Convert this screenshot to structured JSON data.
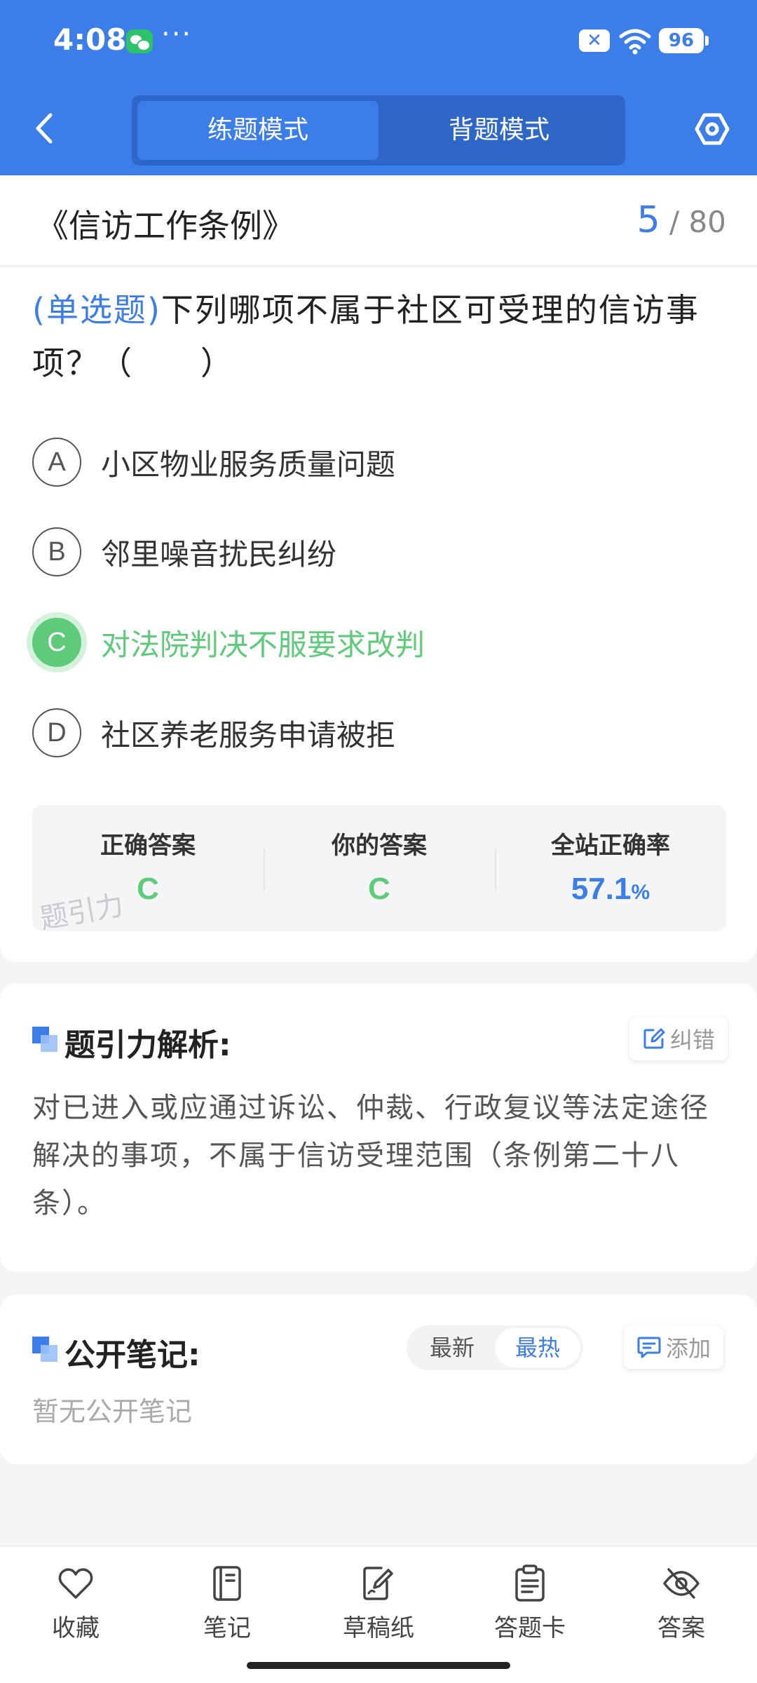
{
  "status_bar": {
    "time": "4:08",
    "dots": "···",
    "battery": "96"
  },
  "header": {
    "tabs": [
      {
        "label": "练题模式",
        "active": true
      },
      {
        "label": "背题模式",
        "active": false
      }
    ]
  },
  "title_bar": {
    "book_title": "《信访工作条例》",
    "current": "5",
    "separator": "/",
    "total": "80"
  },
  "question": {
    "type": "(单选题)",
    "text": "下列哪项不属于社区可受理的信访事项？（　　）",
    "options": [
      {
        "letter": "A",
        "text": "小区物业服务质量问题"
      },
      {
        "letter": "B",
        "text": "邻里噪音扰民纠纷"
      },
      {
        "letter": "C",
        "text": "对法院判决不服要求改判",
        "correct": true
      },
      {
        "letter": "D",
        "text": "社区养老服务申请被拒"
      }
    ]
  },
  "answers": {
    "correct_label": "正确答案",
    "correct_value": "C",
    "yours_label": "你的答案",
    "yours_value": "C",
    "rate_label": "全站正确率",
    "rate_value": "57.1",
    "rate_unit": "%",
    "watermark": "题引力"
  },
  "analysis": {
    "title": "题引力解析:",
    "correct_button": "纠错",
    "text": "对已进入或应通过诉讼、仲裁、行政复议等法定途径解决的事项，不属于信访受理范围（条例第二十八条）。"
  },
  "notes": {
    "title": "公开笔记:",
    "sort_latest": "最新",
    "sort_hot": "最热",
    "add_button": "添加",
    "empty": "暂无公开笔记"
  },
  "bottom_nav": [
    {
      "label": "收藏",
      "icon": "heart-icon"
    },
    {
      "label": "笔记",
      "icon": "notebook-icon"
    },
    {
      "label": "草稿纸",
      "icon": "draft-paper-icon"
    },
    {
      "label": "答题卡",
      "icon": "answer-card-icon"
    },
    {
      "label": "答案",
      "icon": "eye-off-icon"
    }
  ],
  "colors": {
    "primary": "#3b7de9",
    "correct": "#5dcb7a"
  }
}
